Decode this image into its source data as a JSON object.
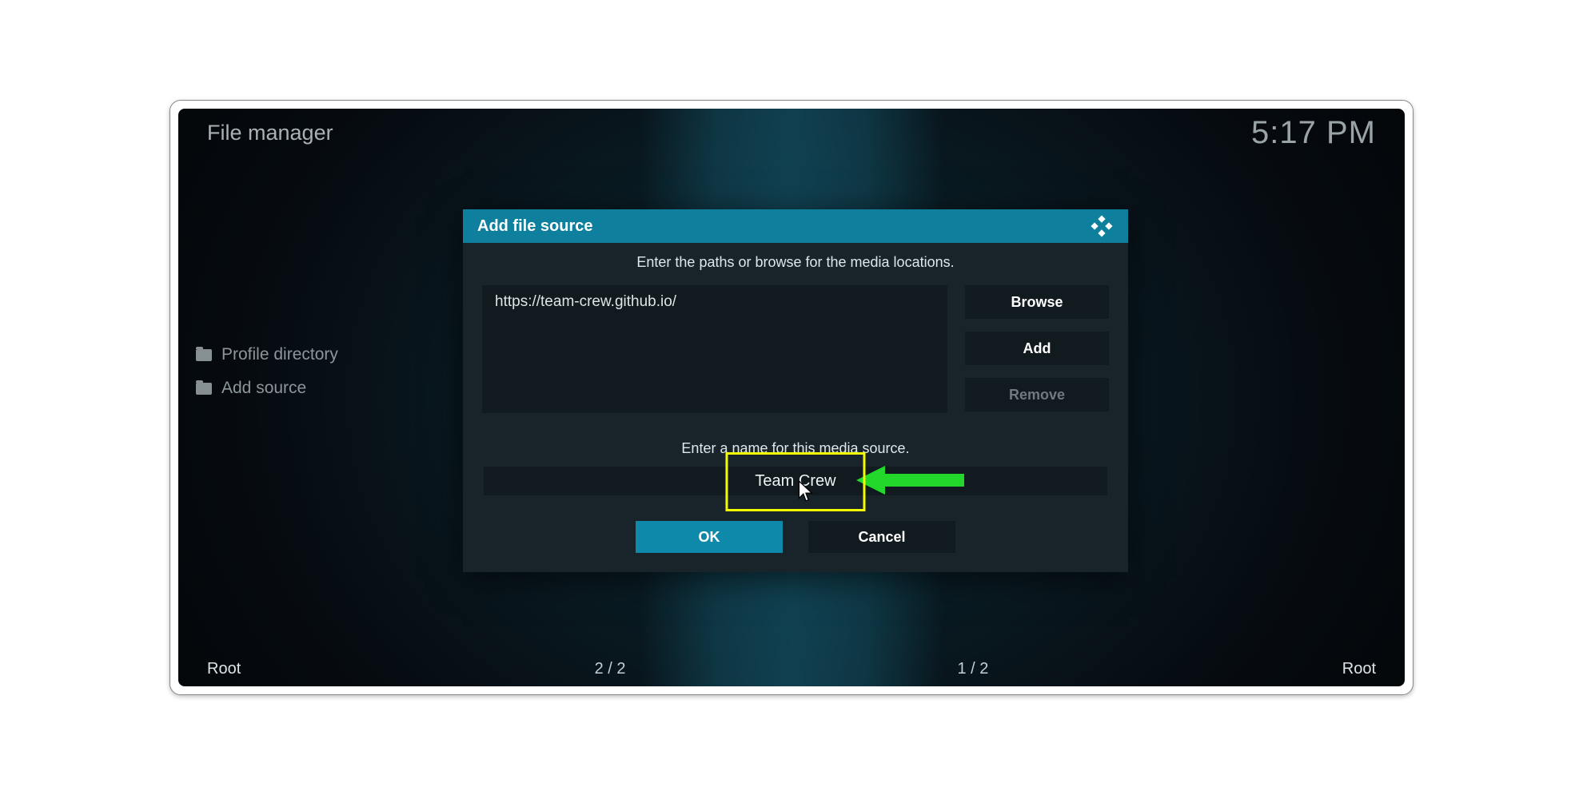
{
  "header": {
    "title": "File manager",
    "clock": "5:17 PM"
  },
  "sidebar": {
    "items": [
      {
        "label": "Profile directory"
      },
      {
        "label": "Add source"
      }
    ]
  },
  "footer": {
    "left_root": "Root",
    "right_root": "Root",
    "left_count": "2 / 2",
    "right_count": "1 / 2"
  },
  "dialog": {
    "title": "Add file source",
    "paths_instruction": "Enter the paths or browse for the media locations.",
    "path_value": "https://team-crew.github.io/",
    "browse_label": "Browse",
    "add_label": "Add",
    "remove_label": "Remove",
    "name_instruction": "Enter a name for this media source.",
    "name_value": "Team Crew",
    "ok_label": "OK",
    "cancel_label": "Cancel"
  }
}
